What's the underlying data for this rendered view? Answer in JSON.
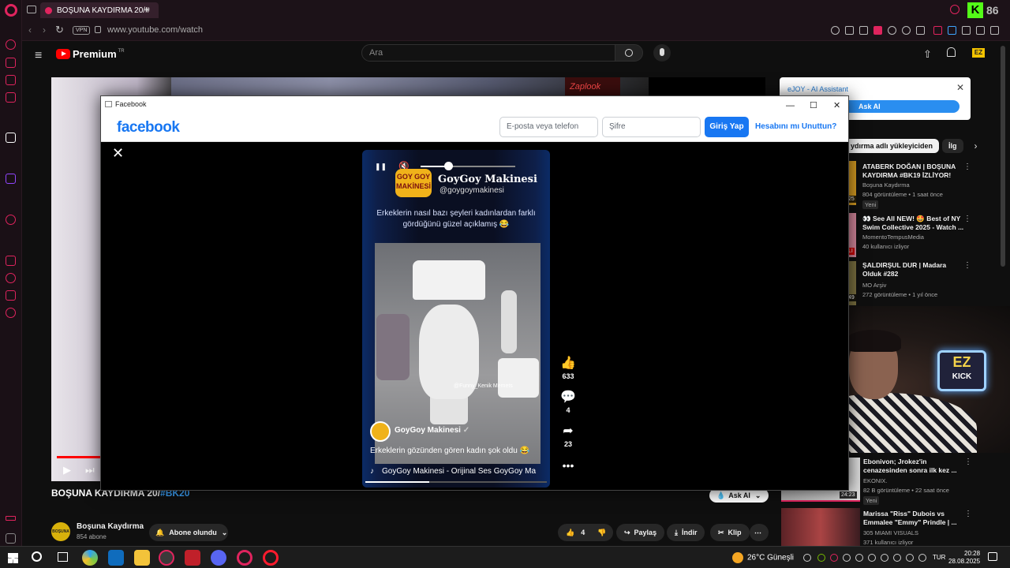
{
  "browser": {
    "tab_title": "BOŞUNA KAYDIRMA 20/#",
    "url": "www.youtube.com/watch",
    "vpn_label": "VPN",
    "new_tab_label": "+"
  },
  "youtube": {
    "brand": "Premium",
    "brand_region": "TR",
    "search_placeholder": "Ara",
    "video_title_main": "BOŞUNA KAYDIRMA 20/",
    "video_title_tag": "#BK20",
    "channel_name": "Boşuna Kaydırma",
    "channel_subs": "854 abone",
    "channel_avatar_text": "BOŞUNA KAYDIRMA",
    "subscribed_label": "Abone olundu",
    "like_count": "4",
    "share_label": "Paylaş",
    "download_label": "İndir",
    "clip_label": "Klip",
    "ask_ai_pill": "Ask AI",
    "behind_video_text": "Zaplook"
  },
  "ejoy": {
    "title": "eJOY - AI Assistant",
    "ask_label": "Ask AI"
  },
  "chips": [
    "ydırma adlı yükleyiciden",
    "İlg"
  ],
  "recommendations": [
    {
      "title": "ATABERK DOĞAN | BOŞUNA KAYDIRMA #BK19 İZLİYOR!",
      "channel": "Boşuna Kaydırma",
      "meta": "804 görüntüleme • 1 saat önce",
      "badge": "Yeni",
      "duration": "25"
    },
    {
      "title": "👀 See All NEW! 🤩 Best of NY Swim Collective 2025 - Watch ...",
      "channel": "MomentoTempusMedia",
      "meta": "40 kullanıcı izliyor",
      "badge": "",
      "duration": "LI"
    },
    {
      "title": "ŞALDIRŞUL DUR | Madara Olduk #282",
      "channel": "MO Arşiv",
      "meta": "272 görüntüleme • 1 yıl önce",
      "badge": "",
      "duration": "49"
    },
    {
      "title": "Ebonivon; Jrokez'in cenazesinden sonra ilk kez ...",
      "channel": "EKONIX.",
      "meta": "82 B görüntüleme • 22 saat önce",
      "badge": "Yeni",
      "duration": "24:23"
    },
    {
      "title": "Marissa \"Riss\" Dubois vs Emmalee \"Emmy\" Prindle | ...",
      "channel": "305 MIAMI VISUALS",
      "meta": "371 kullanıcı izliyor",
      "badge": "",
      "duration": ""
    }
  ],
  "facebook": {
    "window_title": "Facebook",
    "logo": "facebook",
    "email_placeholder": "E-posta veya telefon",
    "password_placeholder": "Şifre",
    "login_label": "Giriş Yap",
    "forgot_label": "Hesabını mı Unuttun?",
    "reel": {
      "logo_text": "GOY GOY MAKİNESİ",
      "title": "GoyGoy Makinesi",
      "handle": "@goygoymakinesi",
      "caption": "Erkeklerin nasıl bazı şeyleri kadınlardan farklı gördüğünü güzel açıklamış 😂",
      "watermark": "@Funny_Kenik Memets",
      "author": "GoyGoy Makinesi",
      "text": "Erkeklerin gözünden gören kadın şok oldu 😂",
      "audio": "GoyGoy Makinesi - Orijinal Ses      GoyGoy Ma",
      "likes": "633",
      "comments": "4",
      "shares": "23",
      "volume": 0.3,
      "progress": 0.35
    }
  },
  "webcam": {
    "sign_top": "EZ",
    "sign_bottom": "KICK"
  },
  "taskbar": {
    "weather_temp": "26°C",
    "weather_text": "Güneşli",
    "lang": "TUR",
    "time": "20:28",
    "date": "28.08.2025"
  },
  "corner_badge": "86",
  "colors": {
    "accent": "#e0245e",
    "fb_blue": "#1877f2",
    "yt_red": "#ff0000"
  }
}
